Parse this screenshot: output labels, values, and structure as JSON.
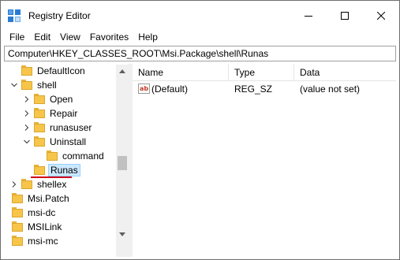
{
  "window": {
    "title": "Registry Editor"
  },
  "menu": [
    "File",
    "Edit",
    "View",
    "Favorites",
    "Help"
  ],
  "address": "Computer\\HKEY_CLASSES_ROOT\\Msi.Package\\shell\\Runas",
  "tree": {
    "items": [
      {
        "label": "DefaultIcon",
        "expander": "none"
      },
      {
        "label": "shell",
        "expander": "expanded"
      },
      {
        "label": "Open",
        "expander": "collapsed"
      },
      {
        "label": "Repair",
        "expander": "collapsed"
      },
      {
        "label": "runasuser",
        "expander": "collapsed"
      },
      {
        "label": "Uninstall",
        "expander": "expanded"
      },
      {
        "label": "command",
        "expander": "none"
      },
      {
        "label": "Runas",
        "expander": "none",
        "selected": true
      },
      {
        "label": "shellex",
        "expander": "collapsed"
      },
      {
        "label": "Msi.Patch",
        "expander": "none"
      },
      {
        "label": "msi-dc",
        "expander": "none"
      },
      {
        "label": "MSILink",
        "expander": "none"
      },
      {
        "label": "msi-mc",
        "expander": "none"
      }
    ]
  },
  "list": {
    "columns": [
      "Name",
      "Type",
      "Data"
    ],
    "rows": [
      {
        "icon": "string-value-icon",
        "icon_text": "ab",
        "name": "(Default)",
        "type": "REG_SZ",
        "data": "(value not set)"
      }
    ]
  },
  "colors": {
    "selection_bg": "#cce8ff",
    "selection_border": "#99d1ff",
    "folder": "#f6c54a",
    "highlight_underline": "#d0021b"
  }
}
